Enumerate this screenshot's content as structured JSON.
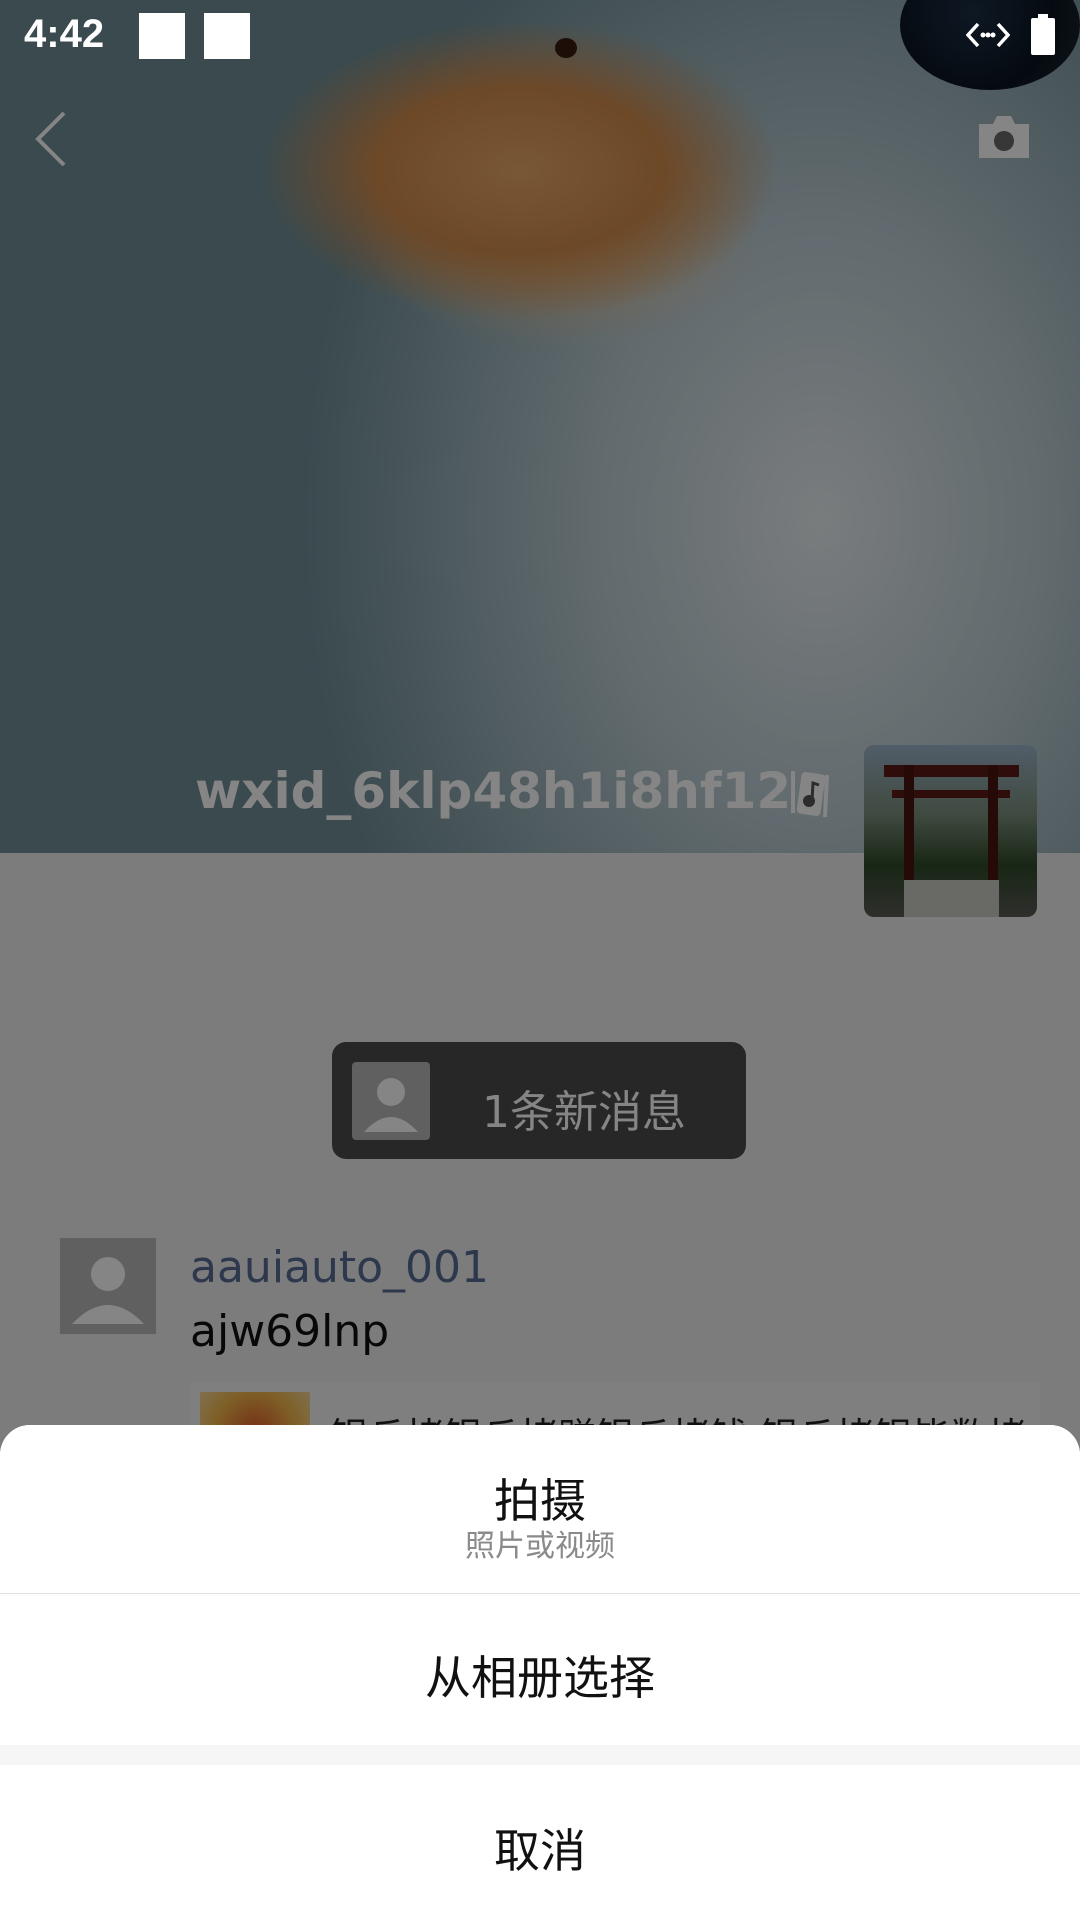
{
  "status_bar": {
    "time": "4:42"
  },
  "profile": {
    "username": "wxid_6klp48h1i8hf12"
  },
  "feed": {
    "new_message_text": "1条新消息",
    "post": {
      "author": "aauiauto_001",
      "text": "ajw69lnp",
      "link_title": "银丘拷银丘拷赚银丘拷钱 银丘拷银毕数拷"
    }
  },
  "action_sheet": {
    "shoot_label": "拍摄",
    "shoot_subtitle": "照片或视频",
    "album_label": "从相册选择",
    "cancel_label": "取消"
  },
  "icons": {
    "back": "chevron-left-icon",
    "camera": "camera-icon",
    "music": "music-note-icon",
    "battery": "battery-icon",
    "data": "data-transfer-icon"
  },
  "colors": {
    "author_link": "#576b95",
    "sheet_background": "#ffffff",
    "overlay": "rgba(0,0,0,0.48)"
  }
}
